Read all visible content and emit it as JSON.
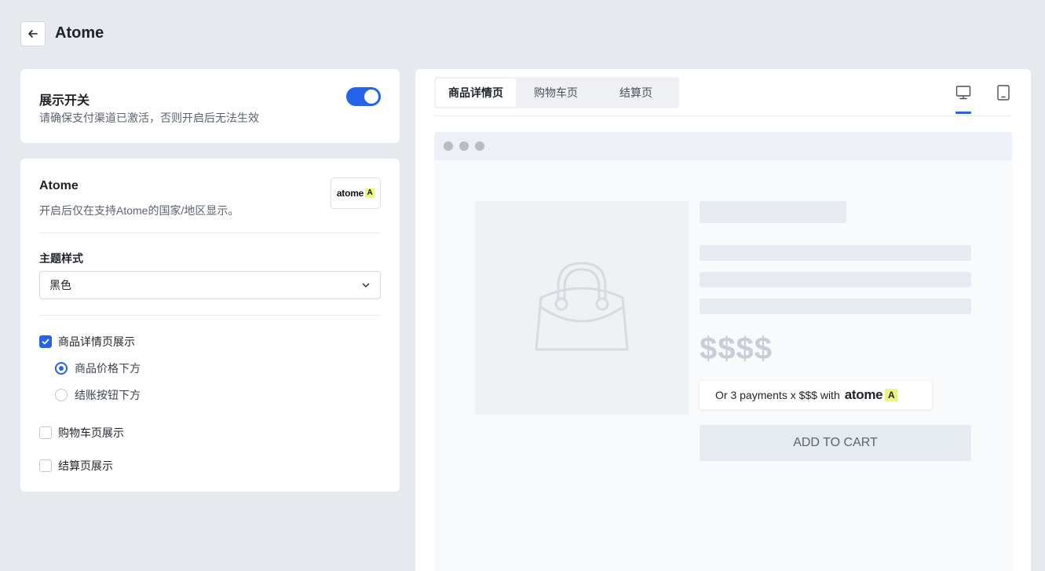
{
  "header": {
    "title": "Atome",
    "back_icon": "arrow-left-icon"
  },
  "display_toggle": {
    "title": "展示开关",
    "description": "请确保支付渠道已激活，否则开启后无法生效",
    "enabled": true
  },
  "settings": {
    "title": "Atome",
    "description": "开启后仅在支持Atome的国家/地区显示。",
    "logo_text": "atome",
    "logo_mark": "A",
    "theme_label": "主题样式",
    "theme_value": "黑色",
    "product_page": {
      "label": "商品详情页展示",
      "checked": true
    },
    "positions": [
      {
        "label": "商品价格下方",
        "selected": true
      },
      {
        "label": "结账按钮下方",
        "selected": false
      }
    ],
    "cart_page": {
      "label": "购物车页展示",
      "checked": false
    },
    "checkout_page": {
      "label": "结算页展示",
      "checked": false
    }
  },
  "preview": {
    "tabs": [
      {
        "label": "商品详情页",
        "active": true
      },
      {
        "label": "购物车页",
        "active": false
      },
      {
        "label": "结算页",
        "active": false
      }
    ],
    "device_icons": [
      "desktop-icon",
      "mobile-icon"
    ],
    "active_device": "desktop",
    "price": "$$$$",
    "pay_text": "Or 3 payments x $$$ with",
    "pay_brand": "atome",
    "pay_mark": "A",
    "add_to_cart": "ADD TO CART"
  },
  "colors": {
    "accent": "#2563eb",
    "brand_yellow": "#e9f77a",
    "background": "#e6e9ee"
  }
}
